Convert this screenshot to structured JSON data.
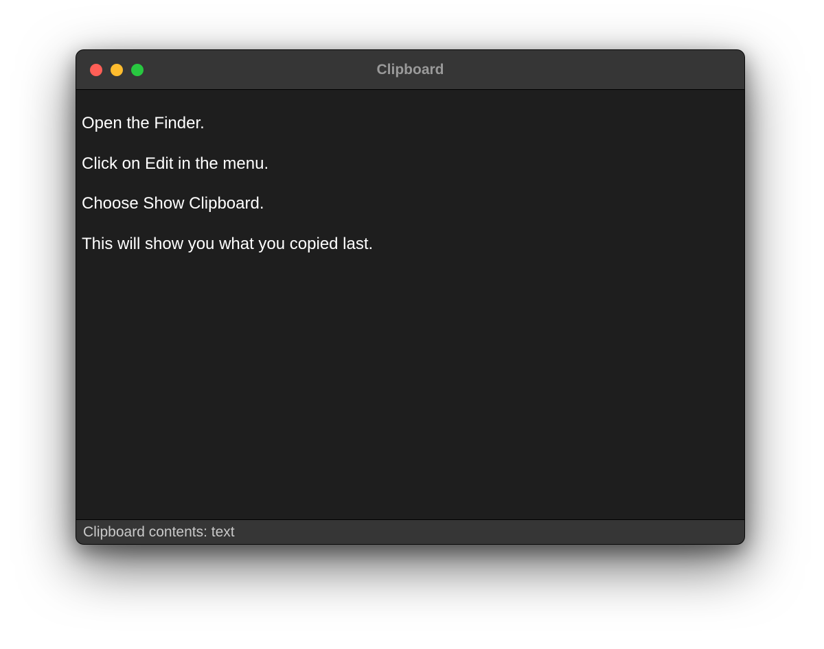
{
  "window": {
    "title": "Clipboard"
  },
  "clipboard": {
    "lines": [
      "Open the Finder.",
      "Click on Edit in the menu.",
      "Choose Show Clipboard.",
      "This will show you what you copied last."
    ]
  },
  "status": {
    "text": "Clipboard contents: text"
  }
}
